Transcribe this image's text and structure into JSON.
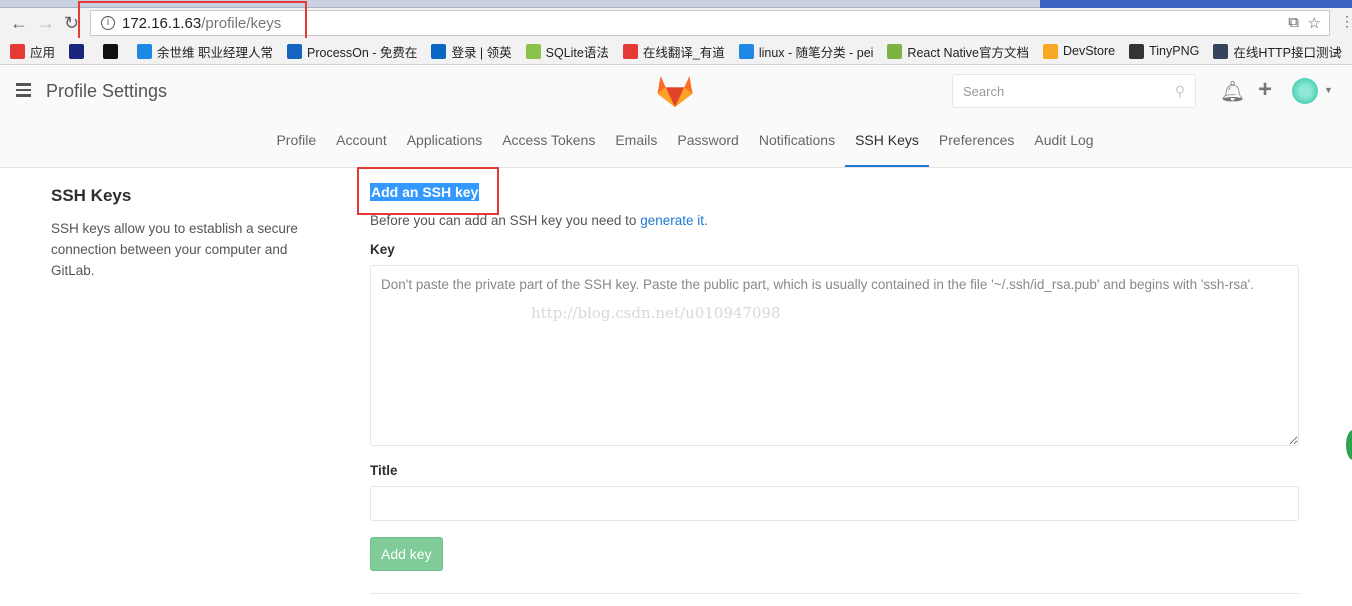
{
  "browser": {
    "url_host": "172.16.1.63",
    "url_path": "/profile/keys",
    "bookmarks": [
      {
        "label": "应用",
        "icon": "apps-grid-icon",
        "color": "#e53935"
      },
      {
        "label": "",
        "icon": "ef-icon",
        "color": "#1a237e"
      },
      {
        "label": "",
        "icon": "github-icon",
        "color": "#111111"
      },
      {
        "label": "余世维 职业经理人常",
        "icon": "play-icon",
        "color": "#1e88e5"
      },
      {
        "label": "ProcessOn - 免费在",
        "icon": "processon-icon",
        "color": "#1565c0"
      },
      {
        "label": "登录 | 领英",
        "icon": "linkedin-icon",
        "color": "#0a66c2"
      },
      {
        "label": "SQLite语法",
        "icon": "sqlite-icon",
        "color": "#8bc34a"
      },
      {
        "label": "在线翻译_有道",
        "icon": "youdao-icon",
        "color": "#e53935"
      },
      {
        "label": "linux - 随笔分类 - pei",
        "icon": "cnblogs-icon",
        "color": "#1e88e5"
      },
      {
        "label": "React Native官方文档",
        "icon": "react-native-cn-icon",
        "color": "#7cb342"
      },
      {
        "label": "DevStore",
        "icon": "devstore-icon",
        "color": "#f9a825"
      },
      {
        "label": "TinyPNG",
        "icon": "panda-icon",
        "color": "#333333"
      },
      {
        "label": "在线HTTP接口测试",
        "icon": "tumblr-icon",
        "color": "#35465c"
      }
    ],
    "more": "»"
  },
  "header": {
    "title": "Profile Settings",
    "search_placeholder": "Search"
  },
  "subnav": [
    "Profile",
    "Account",
    "Applications",
    "Access Tokens",
    "Emails",
    "Password",
    "Notifications",
    "SSH Keys",
    "Preferences",
    "Audit Log"
  ],
  "subnav_active": "SSH Keys",
  "sidebar": {
    "heading": "SSH Keys",
    "description": "SSH keys allow you to establish a secure connection between your computer and GitLab."
  },
  "form": {
    "heading": "Add an SSH key",
    "before_text": "Before you can add an SSH key you need to ",
    "generate_link": "generate it",
    "period": ".",
    "key_label": "Key",
    "key_placeholder": "Don't paste the private part of the SSH key. Paste the public part, which is usually contained in the file '~/.ssh/id_rsa.pub' and begins with 'ssh-rsa'.",
    "title_label": "Title",
    "title_value": "",
    "submit_label": "Add key"
  },
  "watermark": "http://blog.csdn.net/u010947098"
}
